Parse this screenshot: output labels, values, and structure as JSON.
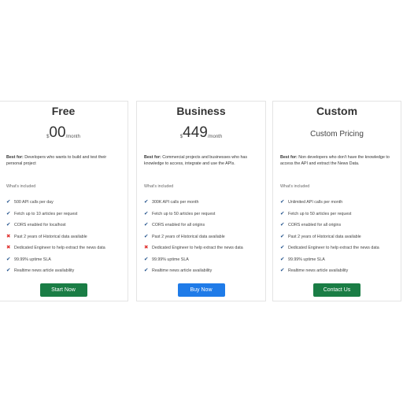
{
  "plans": [
    {
      "name": "Free",
      "currency": "$",
      "amount": "00",
      "period": "/month",
      "best_for_label": "Best for:",
      "best_for_text": " Developers who wants to build and test their personal project",
      "included_title": "What's included",
      "features": [
        {
          "text": "500 API calls per day",
          "included": true
        },
        {
          "text": "Fetch up to 10 articles per request",
          "included": true
        },
        {
          "text": "CORS enabled for localhost",
          "included": true
        },
        {
          "text": "Past 2 years of Historical data available",
          "included": false
        },
        {
          "text": "Dedicated Engineer to help extract the news data",
          "included": false
        },
        {
          "text": "99.99% uptime SLA",
          "included": true
        },
        {
          "text": "Realtime news article availability",
          "included": true
        }
      ],
      "cta_label": "Start Now",
      "cta_color": "#1a7d45"
    },
    {
      "name": "Business",
      "currency": "$",
      "amount": "449",
      "period": "/month",
      "best_for_label": "Best for:",
      "best_for_text": " Commercial projects and businesses who has knowledge to access, integrate and use the APIs.",
      "included_title": "What's included",
      "features": [
        {
          "text": "300K API calls per month",
          "included": true
        },
        {
          "text": "Fetch up to 50 articles per request",
          "included": true
        },
        {
          "text": "CORS enabled for all origins",
          "included": true
        },
        {
          "text": "Past 2 years of Historical data available",
          "included": true
        },
        {
          "text": "Dedicated Engineer to help extract the news data",
          "included": false
        },
        {
          "text": "99.99% uptime SLA",
          "included": true
        },
        {
          "text": "Realtime news article availability",
          "included": true
        }
      ],
      "cta_label": "Buy Now",
      "cta_color": "#1f7be8"
    },
    {
      "name": "Custom",
      "pricing_text": "Custom Pricing",
      "best_for_label": "Best for:",
      "best_for_text": " Non developers who don't have the knowledge to access the API and extract the News Data.",
      "included_title": "What's included",
      "features": [
        {
          "text": "Unlimited API calls per month",
          "included": true
        },
        {
          "text": "Fetch up to 50 articles per request",
          "included": true
        },
        {
          "text": "CORS enabled for all origins",
          "included": true
        },
        {
          "text": "Past 2 years of Historical data available",
          "included": true
        },
        {
          "text": "Dedicated Engineer to help extract the news data",
          "included": true
        },
        {
          "text": "99.99% uptime SLA",
          "included": true
        },
        {
          "text": "Realtime news article availability",
          "included": true
        }
      ],
      "cta_label": "Contact Us",
      "cta_color": "#1a7d45"
    }
  ],
  "icons": {
    "check": "check-icon",
    "cross": "cross-icon",
    "check_color": "#1e4f8a",
    "cross_color": "#e0312f"
  }
}
